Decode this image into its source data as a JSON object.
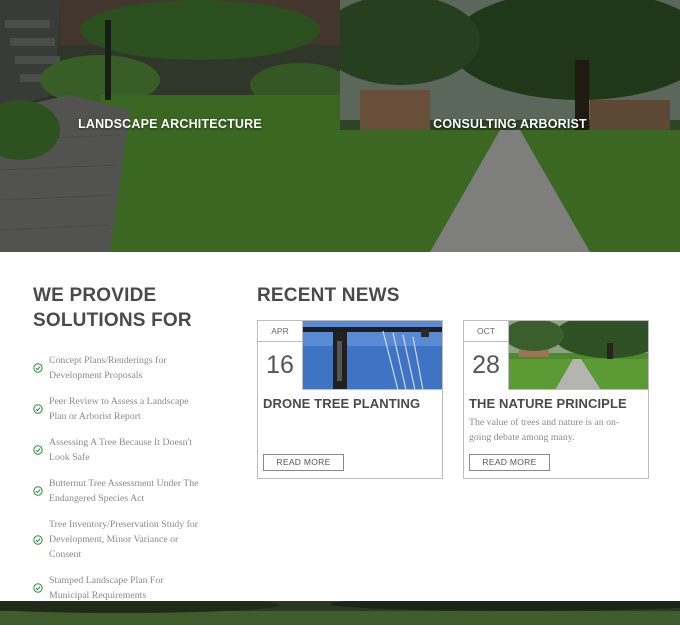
{
  "hero": {
    "tiles": [
      {
        "label": "LANDSCAPE ARCHITECTURE"
      },
      {
        "label": "CONSULTING ARBORIST"
      }
    ]
  },
  "services": {
    "heading_line1": "WE PROVIDE",
    "heading_line2": "SOLUTIONS FOR",
    "items": [
      {
        "line1": "Concept Plans/Renderings for",
        "line2": "Development Proposals"
      },
      {
        "line1": "Peer Review to Assess a Landscape",
        "line2": "Plan or Arborist Report"
      },
      {
        "line1": "Assessing A Tree Because It Doesn't",
        "line2": "Look Safe"
      },
      {
        "line1": "Butternut Tree Assessment Under The",
        "line2": "Endangered Species Act"
      },
      {
        "line1": "Tree Inventory/Preservation Study for",
        "line2": "Development, Minor Variance or",
        "line3": "Consent"
      },
      {
        "line1": "Stamped Landscape Plan For",
        "line2": "Municipal Requirements"
      }
    ],
    "check_icon": "check-circle-icon",
    "accent_color": "#2e8b3e"
  },
  "news": {
    "heading": "RECENT NEWS",
    "cards": [
      {
        "month": "APR",
        "day": "16",
        "title": "DRONE TREE PLANTING",
        "excerpt": "",
        "button": "READ MORE"
      },
      {
        "month": "OCT",
        "day": "28",
        "title": "THE NATURE PRINCIPLE",
        "excerpt": "The value of trees and nature is an on-going debate among many.",
        "button": "READ MORE"
      }
    ]
  }
}
